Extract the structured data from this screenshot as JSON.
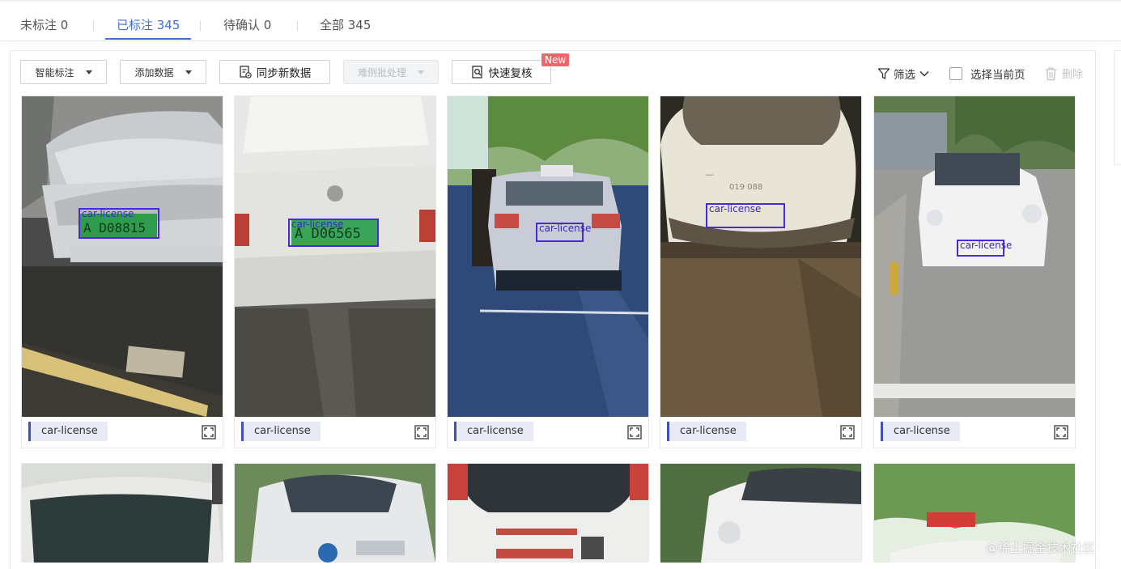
{
  "tabs": [
    {
      "label": "未标注 0"
    },
    {
      "label": "已标注 345"
    },
    {
      "label": "待确认 0"
    },
    {
      "label": "全部 345"
    }
  ],
  "toolbar": {
    "smart_label": "智能标注",
    "add_data": "添加数据",
    "sync_data": "同步新数据",
    "batch_process": "难例批处理",
    "quick_review": "快速复核",
    "new_badge": "New",
    "filter": "筛选",
    "select_page": "选择当前页",
    "delete": "删除"
  },
  "cards": [
    {
      "tag": "car-license",
      "box_label": "car-license"
    },
    {
      "tag": "car-license",
      "box_label": "car-license"
    },
    {
      "tag": "car-license",
      "box_label": "car-license"
    },
    {
      "tag": "car-license",
      "box_label": "car-license"
    },
    {
      "tag": "car-license",
      "box_label": "car-license"
    }
  ],
  "plates": [
    "A D08815",
    "A D06565",
    "019 088"
  ],
  "watermark": "@稀土掘金技术社区",
  "colors": {
    "accent": "#3f6fd6",
    "bbox": "#4a2ad8",
    "tag_bar": "#3f51b5",
    "badge": "#f0666c"
  }
}
